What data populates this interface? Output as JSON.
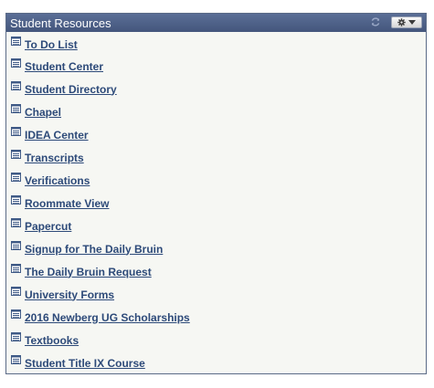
{
  "pagelet": {
    "title": "Student Resources",
    "header_icons": {
      "refresh": "refresh-icon",
      "options": "gear-icon",
      "options_dropdown": "chevron-down-icon"
    },
    "links": [
      {
        "label": "To Do List",
        "icon": "list-icon"
      },
      {
        "label": "Student Center",
        "icon": "list-icon"
      },
      {
        "label": "Student Directory",
        "icon": "list-icon"
      },
      {
        "label": "Chapel",
        "icon": "list-icon"
      },
      {
        "label": "IDEA Center",
        "icon": "list-icon"
      },
      {
        "label": "Transcripts",
        "icon": "list-icon"
      },
      {
        "label": "Verifications",
        "icon": "list-icon"
      },
      {
        "label": "Roommate View",
        "icon": "list-icon"
      },
      {
        "label": "Papercut",
        "icon": "list-icon"
      },
      {
        "label": "Signup for The Daily Bruin",
        "icon": "list-icon"
      },
      {
        "label": "The Daily Bruin Request",
        "icon": "list-icon"
      },
      {
        "label": "University Forms",
        "icon": "list-icon"
      },
      {
        "label": "2016 Newberg UG Scholarships",
        "icon": "list-icon"
      },
      {
        "label": "Textbooks",
        "icon": "list-icon"
      },
      {
        "label": "Student Title IX Course",
        "icon": "list-icon"
      }
    ]
  },
  "colors": {
    "header_bg": "#4d6089",
    "header_text": "#ffffff",
    "body_bg": "#f6f7f3",
    "link": "#2d4a79",
    "border": "#5b6b87"
  }
}
